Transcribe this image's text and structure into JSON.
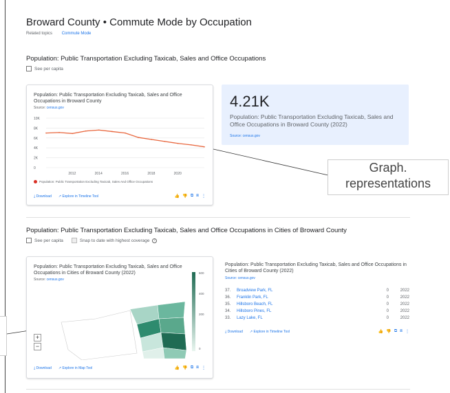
{
  "page": {
    "title": "Broward County • Commute Mode by Occupation",
    "related_label": "Related topics",
    "related_link": "Commute Mode"
  },
  "section1": {
    "title": "Population: Public Transportation Excluding Taxicab, Sales and Office Occupations",
    "per_capita": "See per capita",
    "chart_card": {
      "title": "Population: Public Transportation Excluding Taxicab, Sales and Office Occupations in Broward County",
      "source_label": "Source:",
      "source_link": "census.gov",
      "legend": "Population: Public Transportation Excluding Taxicab, Sales And Office Occupations",
      "download": "Download",
      "explore": "Explore in Timeline Tool"
    },
    "highlight": {
      "value": "4.21K",
      "description": "Population: Public Transportation Excluding Taxicab, Sales and Office Occupations in Broward County (2022)",
      "source": "Source: census.gov"
    }
  },
  "section2": {
    "title": "Population: Public Transportation Excluding Taxicab, Sales and Office Occupations in Cities of Broward County",
    "per_capita": "See per capita",
    "snap": "Snap to date with highest coverage",
    "map_card": {
      "title": "Population: Public Transportation Excluding Taxicab, Sales and Office Occupations in Cities of Broward County (2022)",
      "source_label": "Source:",
      "source_link": "census.gov",
      "legend_ticks": [
        "600",
        "400",
        "200",
        "0"
      ],
      "zoom_in": "+",
      "zoom_out": "−",
      "download": "Download",
      "explore": "Explore in Map Tool"
    },
    "ranking": {
      "title": "Population: Public Transportation Excluding Taxicab, Sales and Office Occupations in Cities of Broward County (2022)",
      "source": "Source: census.gov",
      "rows": [
        {
          "rank": "37.",
          "name": "Broadview Park, FL",
          "value": "0",
          "year": "2022"
        },
        {
          "rank": "36.",
          "name": "Franklin Park, FL",
          "value": "0",
          "year": "2022"
        },
        {
          "rank": "35.",
          "name": "Hillsboro Beach, FL",
          "value": "0",
          "year": "2022"
        },
        {
          "rank": "34.",
          "name": "Hillsboro Pines, FL",
          "value": "0",
          "year": "2022"
        },
        {
          "rank": "33.",
          "name": "Lazy Lake, FL",
          "value": "0",
          "year": "2022"
        }
      ],
      "download": "Download",
      "explore": "Explore in Timeline Tool"
    }
  },
  "annotations": {
    "graph_callout": "Graph. representations"
  },
  "chart_data": {
    "type": "line",
    "x": [
      2010,
      2011,
      2012,
      2013,
      2014,
      2015,
      2016,
      2017,
      2018,
      2019,
      2020,
      2021,
      2022
    ],
    "series": [
      {
        "name": "Population: Public Transportation Excluding Taxicab, Sales And Office Occupations",
        "values": [
          7000,
          7100,
          6900,
          7400,
          7600,
          7300,
          7000,
          6100,
          5700,
          5300,
          4900,
          4600,
          4210
        ]
      }
    ],
    "yticks": [
      "10K",
      "8K",
      "6K",
      "4K",
      "2K",
      "0"
    ],
    "xticks": [
      "2012",
      "2014",
      "2016",
      "2018",
      "2020"
    ],
    "ylim": [
      0,
      10000
    ],
    "color": "#e8663d"
  }
}
